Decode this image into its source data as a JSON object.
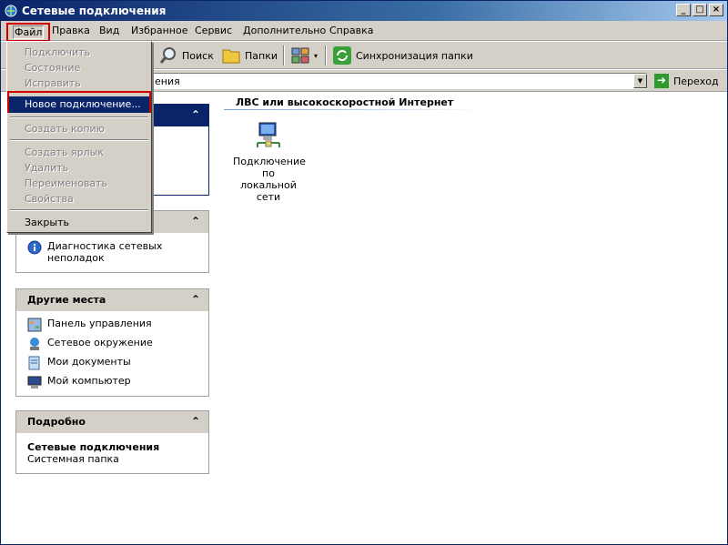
{
  "window": {
    "title": "Сетевые подключения"
  },
  "menubar": {
    "items": [
      "Файл",
      "Правка",
      "Вид",
      "Избранное",
      "Сервис",
      "Дополнительно",
      "Справка"
    ]
  },
  "toolbar": {
    "search": "Поиск",
    "folders": "Папки",
    "sync": "Синхронизация папки"
  },
  "address": {
    "value": "ения",
    "go": "Переход"
  },
  "file_menu": {
    "items": [
      {
        "label": "Подключить",
        "enabled": false
      },
      {
        "label": "Состояние",
        "enabled": false
      },
      {
        "label": "Исправить",
        "enabled": false
      },
      {
        "label": "Новое подключение...",
        "enabled": true,
        "selected": true
      },
      {
        "label": "Создать копию",
        "enabled": false
      },
      {
        "label": "Создать ярлык",
        "enabled": false
      },
      {
        "label": "Удалить",
        "enabled": false
      },
      {
        "label": "Переименовать",
        "enabled": false
      },
      {
        "label": "Свойства",
        "enabled": false
      },
      {
        "label": "Закрыть",
        "enabled": true
      }
    ]
  },
  "panes": {
    "troubleshoot": {
      "items": [
        "Диагностика сетевых неполадок"
      ]
    },
    "other_places": {
      "title": "Другие места",
      "items": [
        "Панель управления",
        "Сетевое окружение",
        "Мои документы",
        "Мой компьютер"
      ]
    },
    "details": {
      "title": "Подробно",
      "name": "Сетевые подключения",
      "type": "Системная папка"
    }
  },
  "content": {
    "group_title": "ЛВС или высокоскоростной Интернет",
    "connection_label": "Подключение по локальной сети"
  },
  "colors": {
    "menu_highlight": "#0a246a",
    "annotation_red": "#d00000",
    "face": "#d4d0c8"
  }
}
